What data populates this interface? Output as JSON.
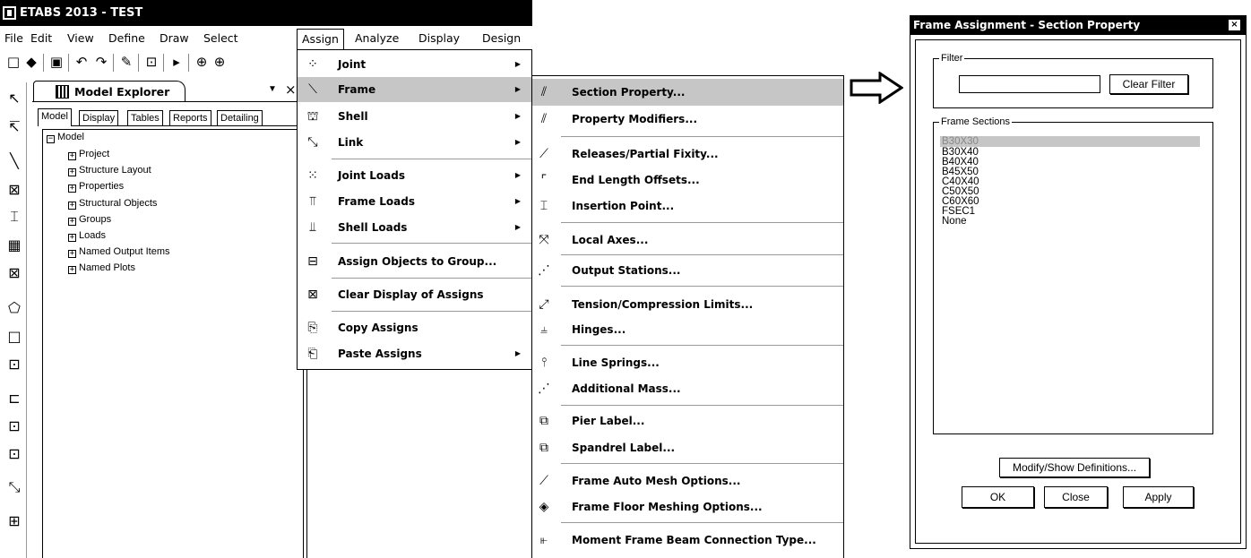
{
  "window_title": "ETABS 2013 - TEST",
  "menubar": [
    "File",
    "Edit",
    "View",
    "Define",
    "Draw",
    "Select",
    "Assign",
    "Analyze",
    "Display",
    "Design"
  ],
  "model_explorer": {
    "title": "Model Explorer",
    "close_glyph": "×",
    "tabs": [
      "Model",
      "Display",
      "Tables",
      "Reports",
      "Detailing"
    ],
    "tree_root": "Model",
    "tree_items": [
      "Project",
      "Structure Layout",
      "Properties",
      "Structural Objects",
      "Groups",
      "Loads",
      "Named Output Items",
      "Named Plots"
    ]
  },
  "assign_menu": {
    "items": [
      {
        "label": "Joint",
        "icon": "joint-icon",
        "submenu": true
      },
      {
        "label": "Frame",
        "icon": "frame-icon",
        "submenu": true,
        "highlighted": true
      },
      {
        "label": "Shell",
        "icon": "shell-icon",
        "submenu": true
      },
      {
        "label": "Link",
        "icon": "link-icon",
        "submenu": true
      },
      {
        "label": "Joint Loads",
        "icon": "joint-loads-icon",
        "submenu": true
      },
      {
        "label": "Frame Loads",
        "icon": "frame-loads-icon",
        "submenu": true
      },
      {
        "label": "Shell Loads",
        "icon": "shell-loads-icon",
        "submenu": true
      },
      {
        "label": "Assign Objects to Group...",
        "icon": "group-icon",
        "submenu": false
      },
      {
        "label": "Clear Display of Assigns",
        "icon": "clear-display-icon",
        "submenu": false
      },
      {
        "label": "Copy Assigns",
        "icon": "copy-icon",
        "submenu": false
      },
      {
        "label": "Paste Assigns",
        "icon": "paste-icon",
        "submenu": true
      }
    ]
  },
  "frame_menu": {
    "items": [
      {
        "label": "Section Property...",
        "icon": "section-property-icon",
        "highlighted": true
      },
      {
        "label": "Property Modifiers...",
        "icon": "property-modifiers-icon"
      },
      {
        "label": "Releases/Partial Fixity...",
        "icon": "releases-icon"
      },
      {
        "label": "End Length Offsets...",
        "icon": "end-offsets-icon"
      },
      {
        "label": "Insertion Point...",
        "icon": "insertion-point-icon"
      },
      {
        "label": "Local Axes...",
        "icon": "local-axes-icon"
      },
      {
        "label": "Output Stations...",
        "icon": "output-stations-icon"
      },
      {
        "label": "Tension/Compression Limits...",
        "icon": "tension-compression-icon"
      },
      {
        "label": "Hinges...",
        "icon": "hinges-icon"
      },
      {
        "label": "Line Springs...",
        "icon": "line-springs-icon"
      },
      {
        "label": "Additional Mass...",
        "icon": "additional-mass-icon"
      },
      {
        "label": "Pier Label...",
        "icon": "pier-label-icon"
      },
      {
        "label": "Spandrel Label...",
        "icon": "spandrel-label-icon"
      },
      {
        "label": "Frame Auto Mesh Options...",
        "icon": "auto-mesh-icon"
      },
      {
        "label": "Frame Floor Meshing Options...",
        "icon": "floor-meshing-icon"
      },
      {
        "label": "Moment Frame Beam Connection Type...",
        "icon": "beam-connection-icon"
      }
    ]
  },
  "dialog": {
    "title": "Frame Assignment - Section Property",
    "close_glyph": "×",
    "filter_group_label": "Filter",
    "filter_value": "",
    "clear_filter_label": "Clear Filter",
    "sections_group_label": "Frame Sections",
    "sections": [
      "B30X30",
      "B30X40",
      "B40X40",
      "B45X50",
      "C40X40",
      "C50X50",
      "C60X60",
      "FSEC1",
      "None"
    ],
    "selected_section": "B30X30",
    "modify_button": "Modify/Show Definitions...",
    "ok_button": "OK",
    "close_button": "Close",
    "apply_button": "Apply"
  },
  "colors": {
    "highlight": "#c6c6c6",
    "titlebar": "#000000",
    "background": "#ffffff"
  }
}
